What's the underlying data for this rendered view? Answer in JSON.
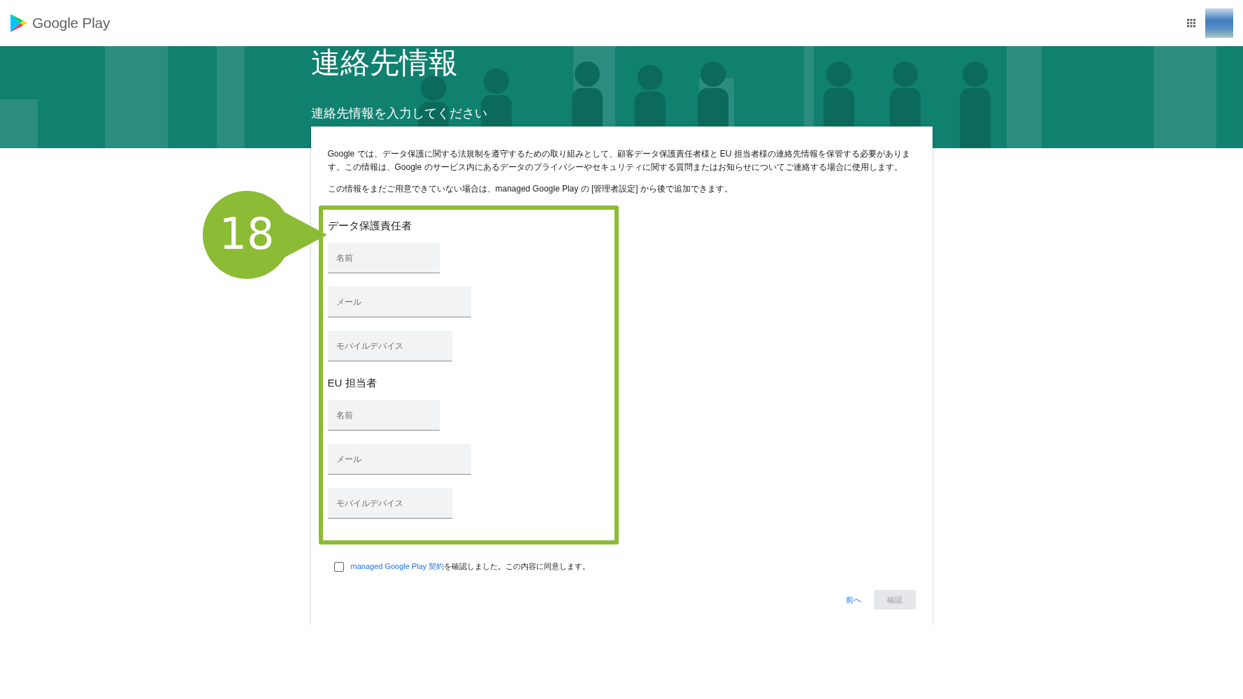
{
  "header": {
    "logo_text": "Google Play"
  },
  "banner": {
    "title": "連絡先情報",
    "subtitle": "連絡先情報を入力してください"
  },
  "intro": [
    "Google では、データ保護に関する法規制を遵守するための取り組みとして、顧客データ保護責任者様と EU 担当者様の連絡先情報を保管する必要があります。この情報は、Google のサービス内にあるデータのプライバシーやセキュリティに関する質問またはお知らせについてご連絡する場合に使用します。",
    "この情報をまだご用意できていない場合は、managed Google Play の [管理者設定] から後で追加できます。"
  ],
  "step_badge": "18",
  "sections": [
    {
      "heading": "データ保護責任者",
      "fields": [
        {
          "kind": "name",
          "placeholder": "名前"
        },
        {
          "kind": "email",
          "placeholder": "メール"
        },
        {
          "kind": "phone",
          "placeholder": "モバイルデバイス"
        }
      ]
    },
    {
      "heading": "EU 担当者",
      "fields": [
        {
          "kind": "name",
          "placeholder": "名前"
        },
        {
          "kind": "email",
          "placeholder": "メール"
        },
        {
          "kind": "phone",
          "placeholder": "モバイルデバイス"
        }
      ]
    }
  ],
  "agreement": {
    "checked": false,
    "link": "managed Google Play 契約",
    "text": "を確認しました。この内容に同意します。"
  },
  "buttons": {
    "back": "前へ",
    "confirm": {
      "label": "確認",
      "disabled": true
    }
  }
}
